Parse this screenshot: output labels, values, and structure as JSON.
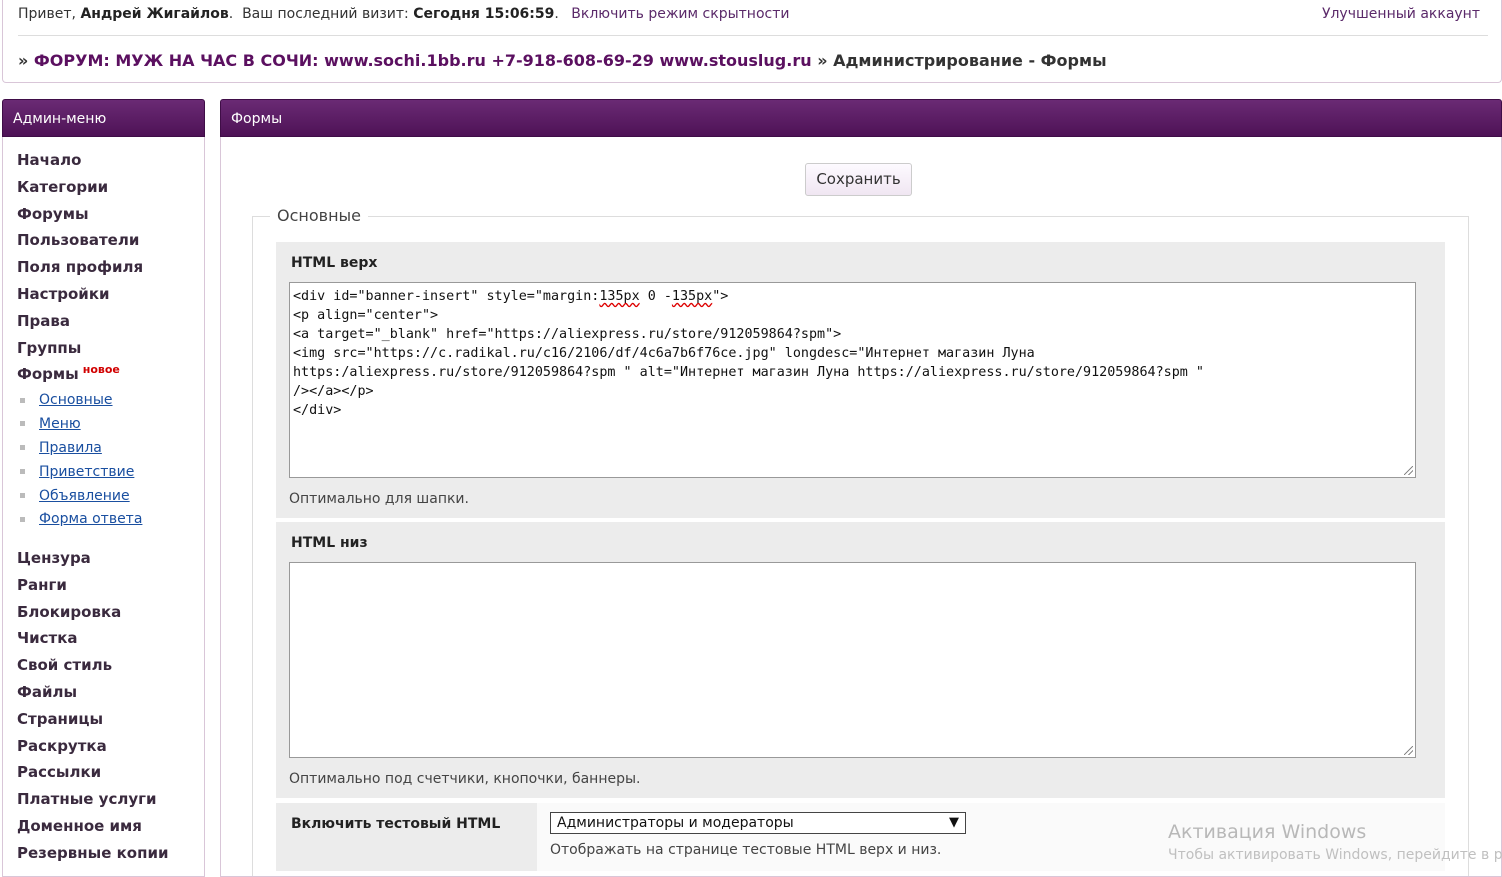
{
  "header": {
    "greeting_prefix": "Привет,",
    "user_name": "Андрей Жигайлов",
    "last_visit_label": "Ваш последний визит:",
    "last_visit_value": "Сегодня 15:06:59",
    "stealth_link": "Включить режим скрытности",
    "premium_link": "Улучшенный аккаунт"
  },
  "breadcrumb": {
    "sep": "»",
    "forum": "ФОРУМ: МУЖ НА ЧАС В СОЧИ: www.sochi.1bb.ru +7-918-608-69-29 www.stouslug.ru",
    "section": "Администрирование",
    "dash": "-",
    "page": "Формы"
  },
  "sidebar": {
    "title": "Админ-меню",
    "items": [
      "Начало",
      "Категории",
      "Форумы",
      "Пользователи",
      "Поля профиля",
      "Настройки",
      "Права",
      "Группы"
    ],
    "forms_item": "Формы",
    "new_badge": "новое",
    "subitems": [
      "Основные",
      "Меню",
      "Правила",
      "Приветствие",
      "Объявление",
      "Форма ответа"
    ],
    "items2": [
      "Цензура",
      "Ранги",
      "Блокировка",
      "Чистка",
      "Свой стиль",
      "Файлы",
      "Страницы",
      "Раскрутка",
      "Рассылки",
      "Платные услуги",
      "Доменное имя",
      "Резервные копии"
    ]
  },
  "main": {
    "title": "Формы",
    "save_label": "Сохранить",
    "fieldset_legend": "Основные",
    "html_top": {
      "label": "HTML верх",
      "hint": "Оптимально для шапки."
    },
    "html_bottom": {
      "label": "HTML низ",
      "value": "",
      "hint": "Оптимально под счетчики, кнопочки, баннеры."
    },
    "test_html": {
      "label": "Включить тестовый HTML",
      "selected": "Администраторы и модераторы",
      "hint": "Отображать на странице тестовые HTML верх и низ."
    }
  },
  "code_lines": {
    "l1a": "<div id=\"banner-insert\" style=\"margin:",
    "l1b": "135px",
    "l1c": " 0 -",
    "l1d": "135px",
    "l1e": "\">",
    "l2": "<p align=\"center\">",
    "l3": "<a target=\"_blank\" href=\"https://aliexpress.ru/store/912059864?spm\">",
    "l4": "<img src=\"https://c.radikal.ru/c16/2106/df/4c6a7b6f76ce.jpg\" longdesc=\"Интернет магазин Луна",
    "l5": "https:/aliexpress.ru/store/912059864?spm \" alt=\"Интернет магазин Луна https://aliexpress.ru/store/912059864?spm \"",
    "l6": "/></a></p>",
    "l7": "</div>"
  },
  "watermark": {
    "title": "Активация Windows",
    "text": "Чтобы активировать Windows, перейдите в раздел"
  }
}
